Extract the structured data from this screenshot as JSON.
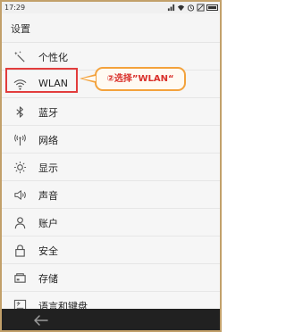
{
  "status_bar": {
    "time": "17:29",
    "icons": [
      "signal-icon",
      "wifi-icon",
      "alarm-icon",
      "silent-icon",
      "battery-icon"
    ]
  },
  "header": {
    "title": "设置"
  },
  "settings_items": [
    {
      "label": "个性化",
      "icon": "magic-wand-icon"
    },
    {
      "label": "WLAN",
      "icon": "wifi-icon"
    },
    {
      "label": "蓝牙",
      "icon": "bluetooth-icon"
    },
    {
      "label": "网络",
      "icon": "antenna-icon"
    },
    {
      "label": "显示",
      "icon": "brightness-icon"
    },
    {
      "label": "声音",
      "icon": "speaker-icon"
    },
    {
      "label": "账户",
      "icon": "person-icon"
    },
    {
      "label": "安全",
      "icon": "lock-icon"
    },
    {
      "label": "存储",
      "icon": "storage-icon"
    },
    {
      "label": "语言和键盘",
      "icon": "keyboard-language-icon"
    }
  ],
  "annotation": {
    "callout_text": "②选择”WLAN“",
    "highlight_color": "#e23c3c",
    "callout_border_color": "#f3a23c"
  },
  "nav_bar": {
    "back_icon": "back-arrow-icon"
  }
}
